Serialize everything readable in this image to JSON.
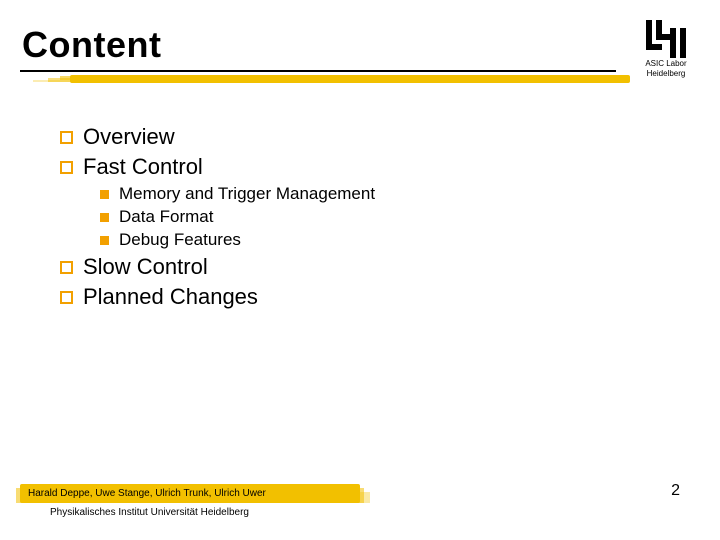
{
  "title": "Content",
  "logo": {
    "line1": "ASIC Labor",
    "line2": "Heidelberg"
  },
  "items": {
    "l1_0": "Overview",
    "l1_1": "Fast Control",
    "l2_0": "Memory and Trigger Management",
    "l2_1": "Data Format",
    "l2_2": "Debug Features",
    "l1_2": "Slow Control",
    "l1_3": "Planned Changes"
  },
  "footer": {
    "authors": "Harald Deppe, Uwe Stange, Ulrich Trunk, Ulrich Uwer",
    "institution": "Physikalisches Institut Universität Heidelberg"
  },
  "page_number": "2"
}
